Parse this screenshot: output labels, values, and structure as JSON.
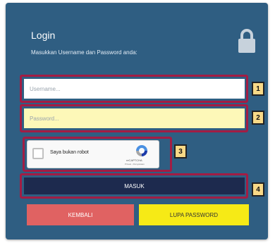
{
  "header": {
    "title": "Login",
    "subtitle": "Masukkan Username dan Password anda:",
    "icon": "lock-icon"
  },
  "form": {
    "username_placeholder": "Username...",
    "password_placeholder": "Password...",
    "captcha": {
      "label": "Saya bukan robot",
      "brand": "reCAPTCHA",
      "terms": "Privasi - Persyaratan"
    },
    "submit_label": "MASUK",
    "back_label": "KEMBALI",
    "forgot_label": "LUPA PASSWORD"
  },
  "markers": [
    "1",
    "2",
    "3",
    "4"
  ],
  "colors": {
    "panel": "#2f5e82",
    "highlight": "#a21d44",
    "submit": "#1d2a4e",
    "back": "#e06262",
    "forgot": "#f6ea16",
    "password_field": "#fdf8b8",
    "marker": "#f8d987"
  }
}
